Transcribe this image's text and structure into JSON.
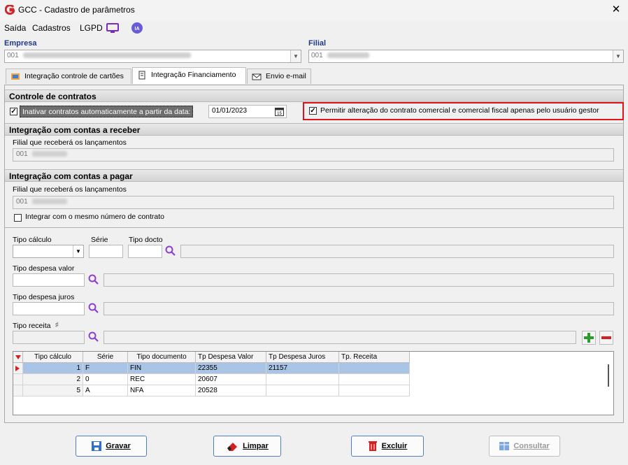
{
  "window": {
    "title": "GCC - Cadastro de parâmetros",
    "close": "✕"
  },
  "menu": {
    "saida": "Saída",
    "cadastros": "Cadastros",
    "lgpd": "LGPD"
  },
  "empresa": {
    "label": "Empresa",
    "value": "001"
  },
  "filial": {
    "label": "Filial",
    "value": "001"
  },
  "tabs": [
    {
      "label": "Integração controle de cartões"
    },
    {
      "label": "Integração Financiamento"
    },
    {
      "label": "Envio e-mail"
    }
  ],
  "controle": {
    "header": "Controle de contratos",
    "inativar_label": "Inativar contratos automaticamente a partir da data:",
    "date_value": "01/01/2023",
    "permitir_label": "Permitir alteração do contrato comercial e comercial fiscal apenas pelo usuário gestor"
  },
  "receber": {
    "header": "Integração com contas a receber",
    "filial_label": "Filial que receberá os lançamentos",
    "filial_value": "001"
  },
  "pagar": {
    "header": "Integração com contas a pagar",
    "filial_label": "Filial que receberá os lançamentos",
    "filial_value": "001",
    "integrar_label": "Integrar com o mesmo número de contrato"
  },
  "form": {
    "tipo_calculo": "Tipo cálculo",
    "serie": "Série",
    "tipo_docto": "Tipo docto",
    "tipo_despesa_valor": "Tipo despesa valor",
    "tipo_despesa_juros": "Tipo despesa juros",
    "tipo_receita": "Tipo receita"
  },
  "grid": {
    "columns": [
      "Tipo cálculo",
      "Série",
      "Tipo documento",
      "Tp Despesa Valor",
      "Tp Despesa Juros",
      "Tp. Receita"
    ],
    "rows": [
      [
        "1",
        "F",
        "FIN",
        "22355",
        "21157",
        ""
      ],
      [
        "2",
        "0",
        "REC",
        "20607",
        "",
        ""
      ],
      [
        "5",
        "A",
        "NFA",
        "20528",
        "",
        ""
      ]
    ]
  },
  "buttons": {
    "gravar": "Gravar",
    "limpar": "Limpar",
    "excluir": "Excluir",
    "consultar": "Consultar"
  },
  "colors": {
    "accent": "#1f3a8a",
    "highlight": "#e0141b",
    "selected_row": "#aac4e6"
  }
}
